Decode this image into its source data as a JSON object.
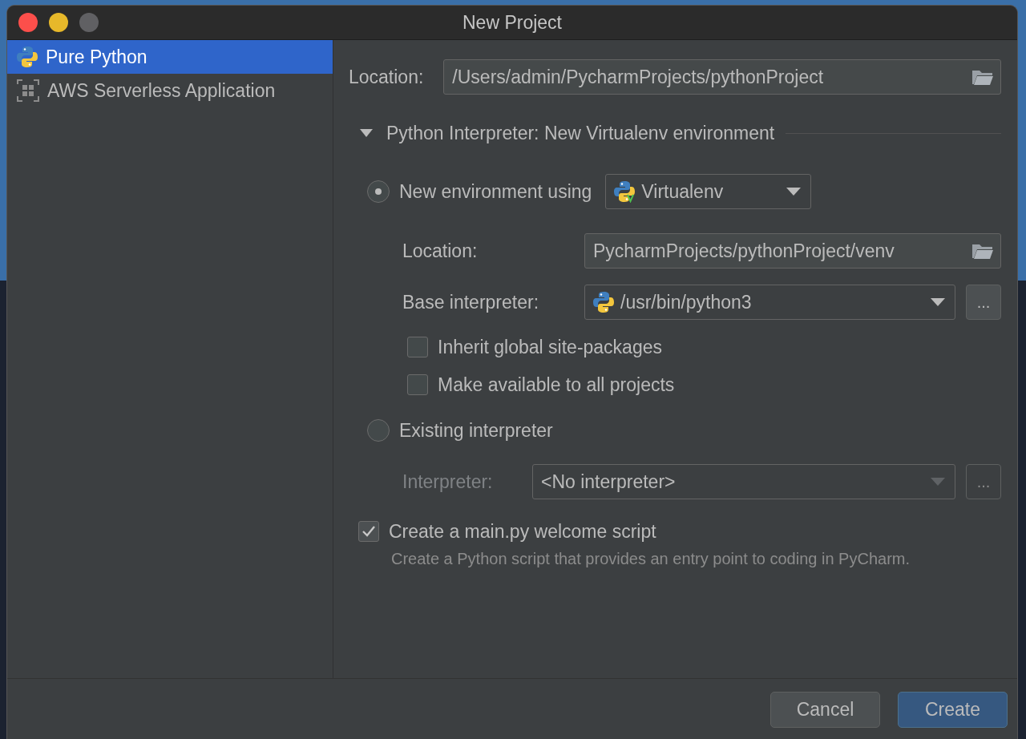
{
  "window": {
    "title": "New Project"
  },
  "sidebar": {
    "items": [
      {
        "label": "Pure Python",
        "kind": "python",
        "selected": true
      },
      {
        "label": "AWS Serverless Application",
        "kind": "aws",
        "selected": false
      }
    ]
  },
  "location": {
    "label": "Location:",
    "value": "/Users/admin/PycharmProjects/pythonProject"
  },
  "interpreter_section": {
    "title": "Python Interpreter: New Virtualenv environment",
    "expanded": true,
    "new_environment": {
      "label": "New environment using",
      "selected": true,
      "tool": "Virtualenv",
      "location": {
        "label": "Location:",
        "value": "PycharmProjects/pythonProject/venv"
      },
      "base_interpreter": {
        "label": "Base interpreter:",
        "value": "/usr/bin/python3",
        "browse": "..."
      },
      "options": [
        {
          "label": "Inherit global site-packages",
          "checked": false
        },
        {
          "label": "Make available to all projects",
          "checked": false
        }
      ]
    },
    "existing": {
      "label": "Existing interpreter",
      "selected": false,
      "interpreter": {
        "label": "Interpreter:",
        "value": "<No interpreter>",
        "disabled": true,
        "browse": "..."
      }
    }
  },
  "welcome_script": {
    "label": "Create a main.py welcome script",
    "checked": true,
    "hint": "Create a Python script that provides an entry point to coding in PyCharm."
  },
  "buttons": [
    {
      "label": "Cancel",
      "kind": "secondary"
    },
    {
      "label": "Create",
      "kind": "primary"
    }
  ]
}
